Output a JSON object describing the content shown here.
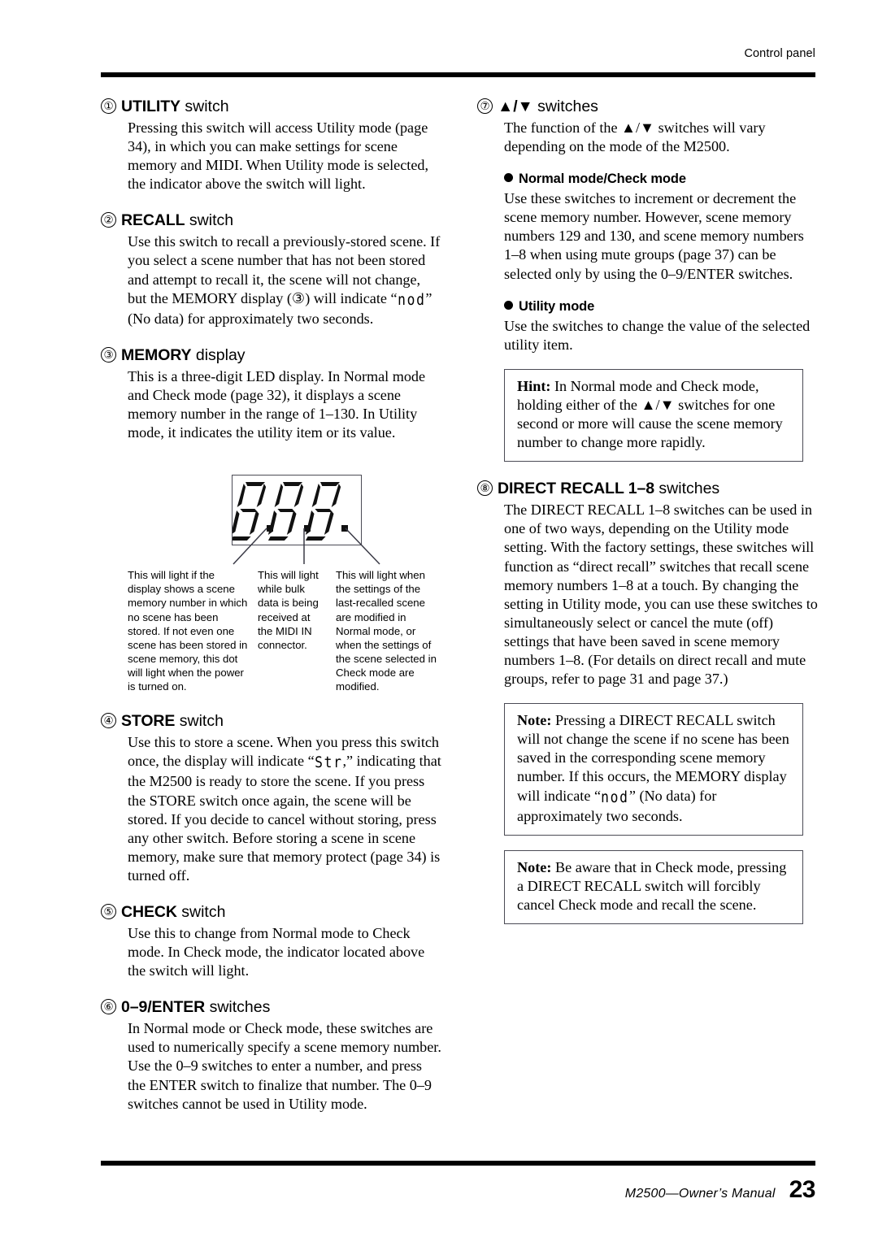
{
  "header": {
    "running_head": "Control panel"
  },
  "footer": {
    "manual_title": "M2500—Owner’s Manual",
    "page_number": "23"
  },
  "left_column": {
    "sections": [
      {
        "number": "①",
        "title_strong": "UTILITY",
        "title_light": " switch",
        "body": "Pressing this switch will access Utility mode (page 34), in which you can make settings for scene memory and MIDI. When Utility mode is selected, the indicator above the switch will light."
      },
      {
        "number": "②",
        "title_strong": "RECALL",
        "title_light": " switch",
        "body_part1": "Use this switch to recall a previously-stored scene. If you select a scene number that has not been stored and attempt to recall it, the scene will not change, but the MEMORY display (③) will indicate “",
        "seg_glyph": "nod",
        "body_part2": "” (No data) for approximately two seconds."
      },
      {
        "number": "③",
        "title_strong": "MEMORY",
        "title_light": " display",
        "body": "This is a three-digit LED display. In Normal mode and Check mode (page 32), it displays a scene memory number in the range of 1–130. In Utility mode, it indicates the utility item or its value."
      },
      {
        "number": "④",
        "title_strong": "STORE",
        "title_light": " switch",
        "body_part1": "Use this to store a scene. When you press this switch once, the display will indicate “",
        "seg_glyph": "Str",
        "body_part2": ",” indicating that the M2500 is ready to store the scene. If you press the STORE switch once again, the scene will be stored. If you decide to cancel without storing, press any other switch. Before storing a scene in scene memory, make sure that memory protect (page 34) is turned off."
      },
      {
        "number": "⑤",
        "title_strong": "CHECK",
        "title_light": " switch",
        "body": "Use this to change from Normal mode to Check mode. In Check mode, the indicator located above the switch will light."
      },
      {
        "number": "⑥",
        "title_strong": "0–9/ENTER",
        "title_light": " switches",
        "body": "In Normal mode or Check mode, these switches are used to numerically specify a scene memory number. Use the 0–9 switches to enter a number, and press the ENTER switch to finalize that number. The 0–9 switches cannot be used in Utility mode."
      }
    ],
    "figure": {
      "display_value": "8.8.8.",
      "callouts": [
        "This will light if the display shows a scene memory number in which no scene has been stored. If not even one scene has been stored in scene memory, this dot will light when the power is turned on.",
        "This will light while bulk data is being received at the MIDI IN connector.",
        "This will light when the settings of the last-recalled scene are modified in Normal mode, or when the settings of the scene selected in Check mode are modified."
      ]
    }
  },
  "right_column": {
    "section7": {
      "number": "⑦",
      "title_strong": "▲/▼",
      "title_light": " switches",
      "intro": "The function of the ▲/▼ switches will vary depending on the mode of the M2500.",
      "sub1_label": "Normal mode/Check mode",
      "sub1_body": "Use these switches to increment or decrement the scene memory number. However, scene memory numbers 129 and 130, and scene memory numbers 1–8 when using mute groups (page 37) can be selected only by using the 0–9/ENTER switches.",
      "sub2_label": "Utility mode",
      "sub2_body": "Use the switches to change the value of the selected utility item.",
      "hint_label": "Hint:",
      "hint_body": " In Normal mode and Check mode, holding either of the ▲/▼ switches for one second or more will cause the scene memory number to change more rapidly."
    },
    "section8": {
      "number": "⑧",
      "title_strong": "DIRECT RECALL 1–8",
      "title_light": " switches",
      "body": "The DIRECT RECALL 1–8 switches can be used in one of two ways, depending on the Utility mode setting. With the factory settings, these switches will function as “direct recall” switches that recall scene memory numbers 1–8 at a touch. By changing the setting in Utility mode, you can use these switches to simultaneously select or cancel the mute (off) settings that have been saved in scene memory numbers 1–8. (For details on direct recall and mute groups, refer to page 31 and page 37.)",
      "note1_label": "Note:",
      "note1_part1": " Pressing a DIRECT RECALL switch will not change the scene if no scene has been saved in the corresponding scene memory number. If this occurs, the MEMORY display will indicate “",
      "note1_seg": "nod",
      "note1_part2": "” (No data) for approximately two seconds.",
      "note2_label": "Note:",
      "note2_body": " Be aware that in Check mode, pressing a DIRECT RECALL switch will forcibly cancel Check mode and recall the scene."
    }
  }
}
